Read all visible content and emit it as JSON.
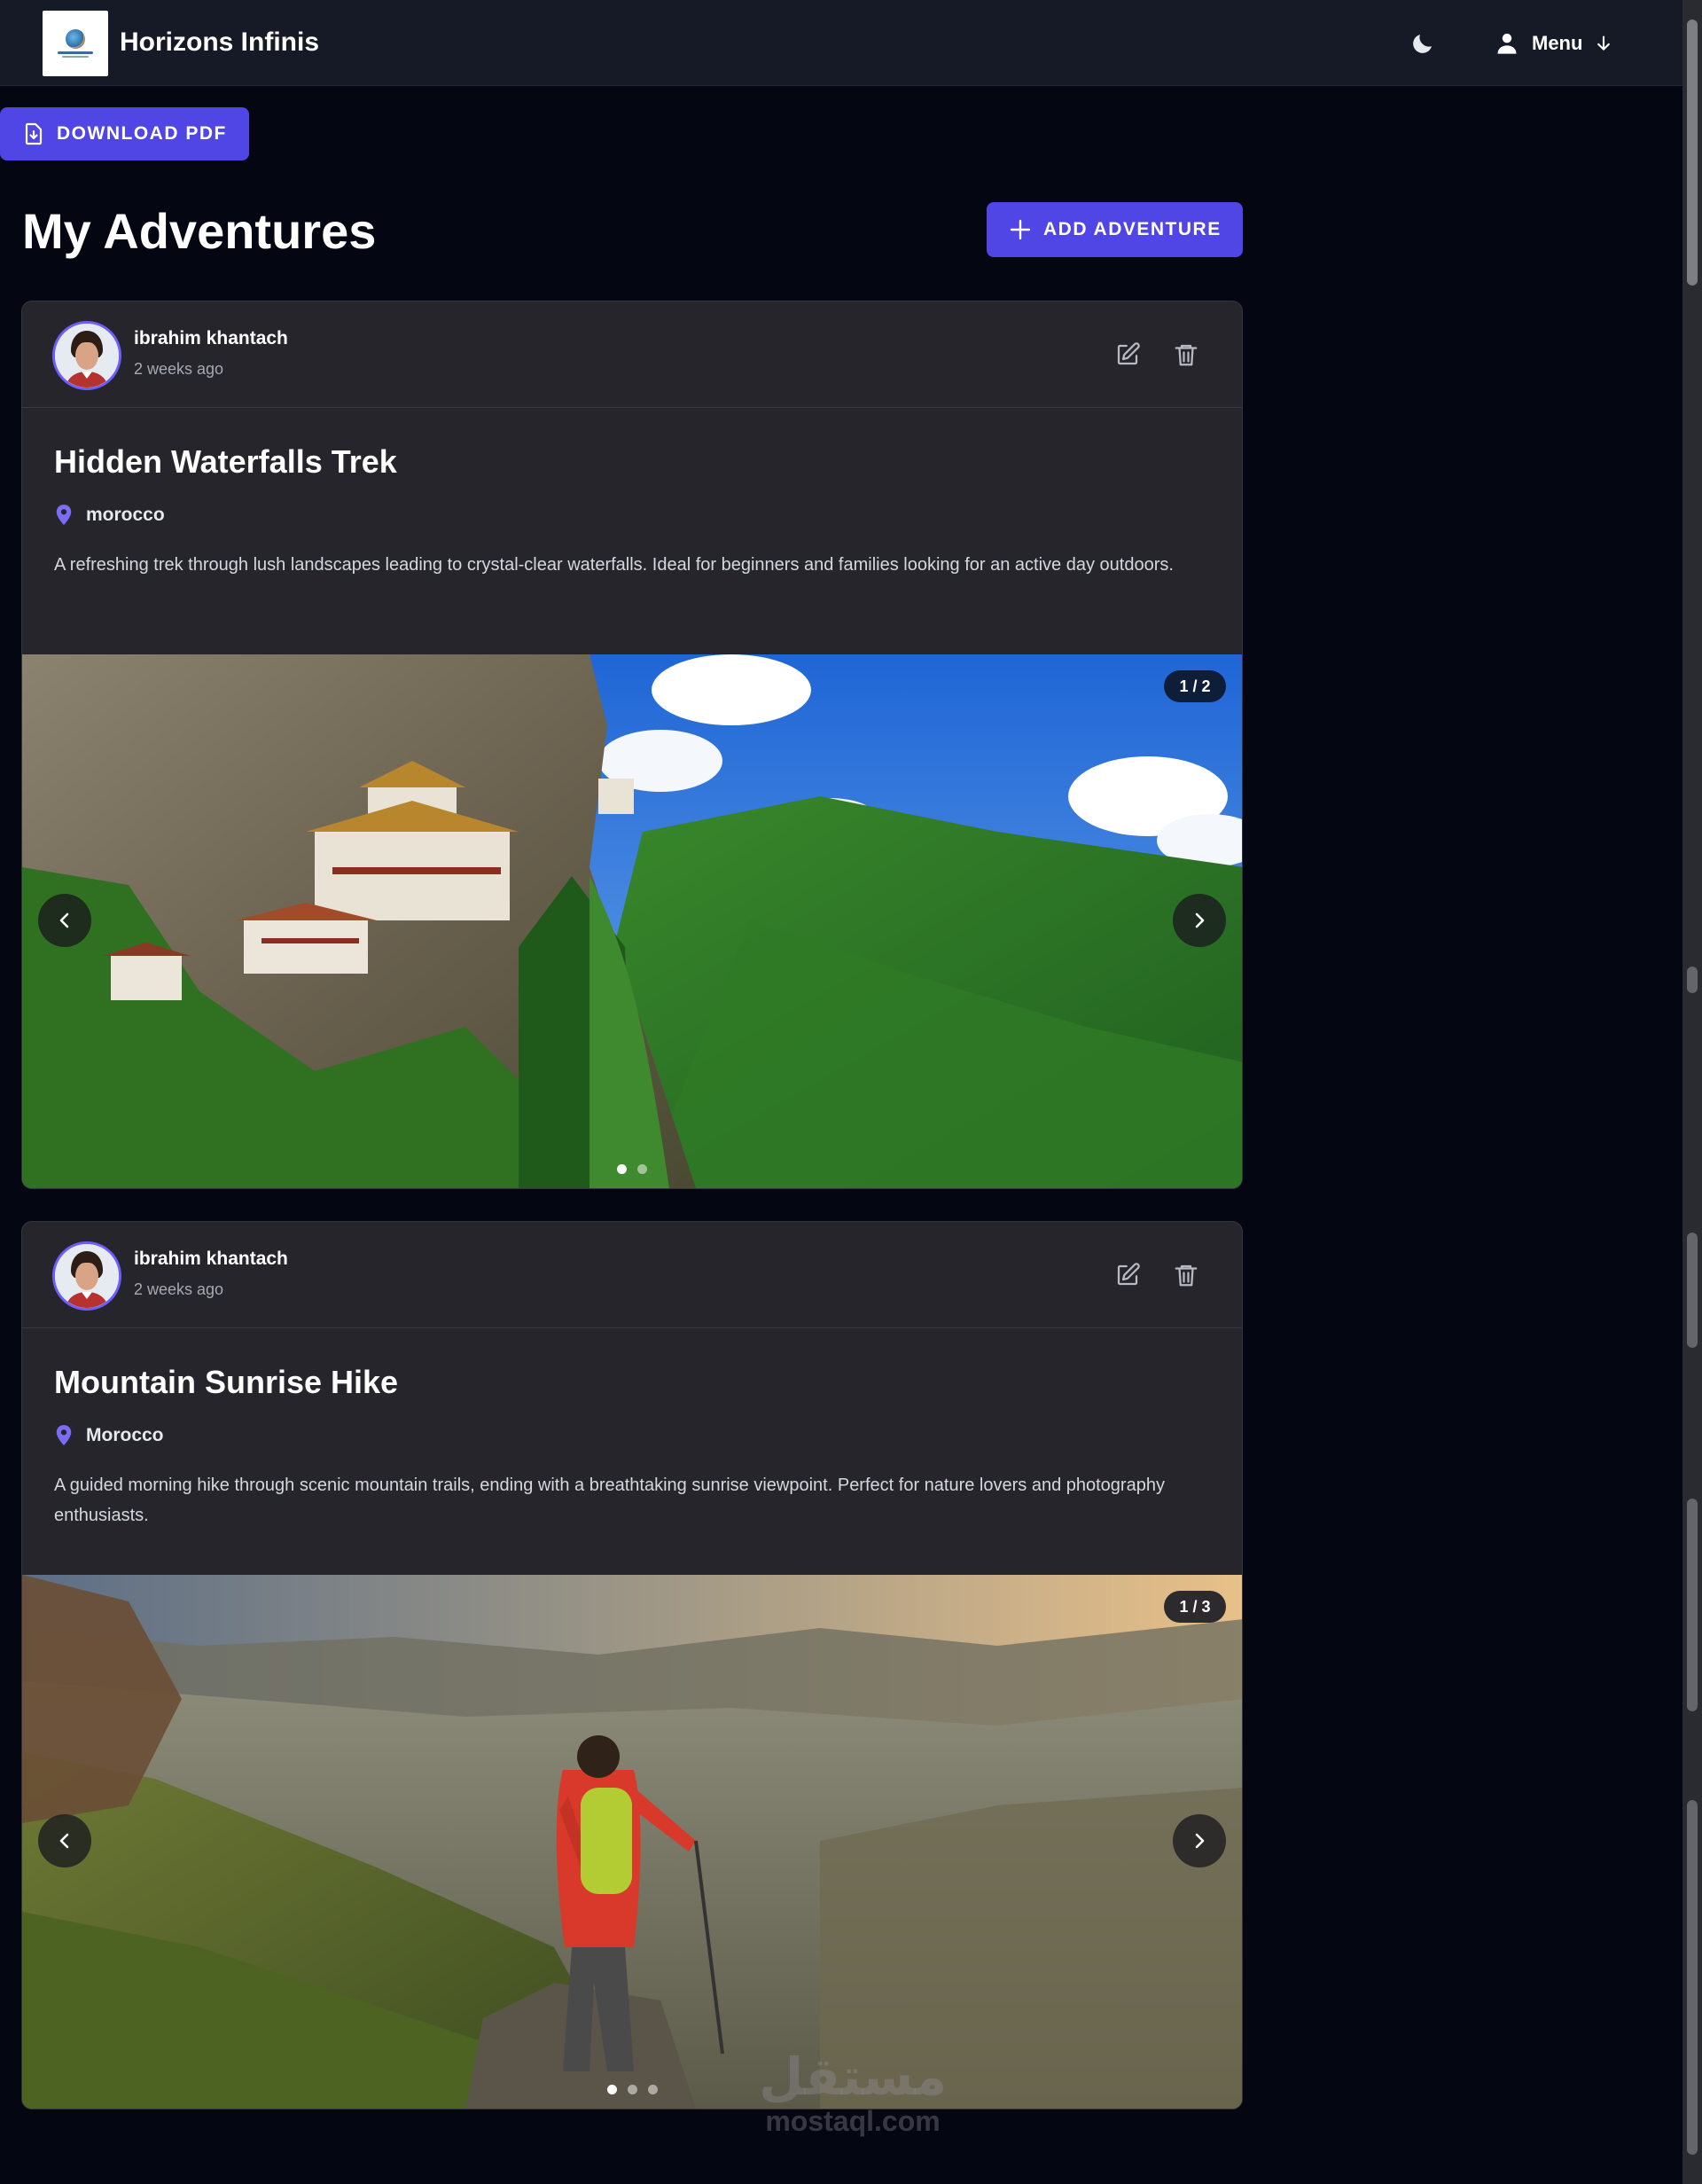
{
  "app": {
    "brand": "Horizons Infinis"
  },
  "header": {
    "menu_label": "Menu"
  },
  "toolbar": {
    "download_label": "DOWNLOAD PDF"
  },
  "page": {
    "title": "My Adventures",
    "add_label": "ADD ADVENTURE"
  },
  "theme": {
    "accent": "#4f46e5",
    "background": "#040611",
    "card": "#25252b"
  },
  "adventures": [
    {
      "author": "ibrahim khantach",
      "time": "2 weeks ago",
      "title": "Hidden Waterfalls Trek",
      "location": "morocco",
      "description": "A refreshing trek through lush landscapes leading to crystal-clear waterfalls. Ideal for beginners and families looking for an active day outdoors.",
      "counter": "1 / 2",
      "image_count": 2,
      "active_index": 0
    },
    {
      "author": "ibrahim khantach",
      "time": "2 weeks ago",
      "title": "Mountain Sunrise Hike",
      "location": "Morocco",
      "description": "A guided morning hike through scenic mountain trails, ending with a breathtaking sunrise viewpoint. Perfect for nature lovers and photography enthusiasts.",
      "counter": "1 / 3",
      "image_count": 3,
      "active_index": 0
    }
  ],
  "watermark": {
    "arabic": "مستقل",
    "latin": "mostaql.com"
  },
  "icons": [
    "moon-icon",
    "user-icon",
    "arrow-down-icon",
    "file-download-icon",
    "plus-icon",
    "edit-icon",
    "trash-icon",
    "map-pin-icon",
    "chevron-left-icon",
    "chevron-right-icon"
  ]
}
